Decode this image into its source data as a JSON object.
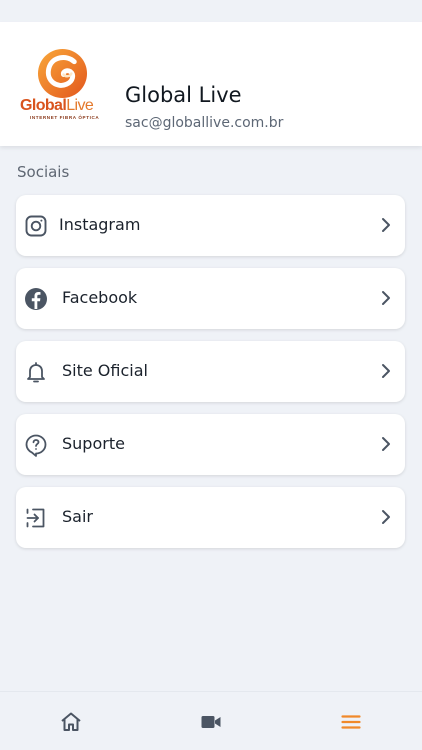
{
  "profile": {
    "name": "Global Live",
    "email": "sac@globallive.com.br",
    "logo": {
      "brand_bold": "Global",
      "brand_light": "Live",
      "tagline": "INTERNET FIBRA ÓPTICA"
    }
  },
  "section": {
    "title": "Sociais"
  },
  "menu": {
    "items": [
      {
        "label": "Instagram",
        "icon": "instagram-icon"
      },
      {
        "label": "Facebook",
        "icon": "facebook-icon"
      },
      {
        "label": "Site Oficial",
        "icon": "bell-icon"
      },
      {
        "label": "Suporte",
        "icon": "help-bubble-icon"
      },
      {
        "label": "Sair",
        "icon": "logout-icon"
      }
    ]
  },
  "bottom_nav": {
    "items": [
      {
        "icon": "home-icon",
        "active": false
      },
      {
        "icon": "video-camera-icon",
        "active": false
      },
      {
        "icon": "menu-icon",
        "active": true
      }
    ]
  },
  "colors": {
    "accent": "#f0892a",
    "icon": "#4b5563",
    "background": "#eff2f7",
    "card": "#ffffff"
  }
}
